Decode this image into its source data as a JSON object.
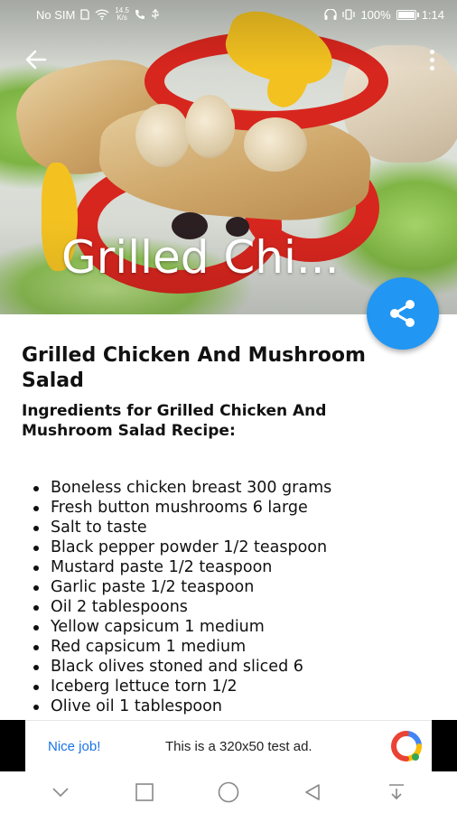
{
  "status_bar": {
    "carrier": "No SIM",
    "speed_value": "14.5",
    "speed_unit": "K/s",
    "battery": "100%",
    "battery_level": 1.0,
    "time": "1:14"
  },
  "hero": {
    "title": "Grilled Chi..."
  },
  "icons": {
    "back": "arrow-back-icon",
    "menu": "more-vert-icon",
    "share": "share-icon"
  },
  "recipe": {
    "title": "Grilled Chicken And Mushroom Salad",
    "ingredients_heading": "Ingredients for Grilled Chicken And Mushroom Salad Recipe:",
    "ingredients": [
      "Boneless chicken breast 300 grams",
      "Fresh button mushrooms 6 large",
      "Salt to taste",
      "Black pepper powder 1/2 teaspoon",
      "Mustard paste 1/2 teaspoon",
      "Garlic paste 1/2 teaspoon",
      "Oil 2 tablespoons",
      "Yellow capsicum 1 medium",
      "Red capsicum 1 medium",
      "Black olives stoned and sliced 6",
      "Iceberg lettuce torn 1/2",
      "Olive oil 1 tablespoon"
    ]
  },
  "ad": {
    "nice_job": "Nice job!",
    "text": "This is a 320x50 test ad."
  },
  "colors": {
    "fab": "#2196f3",
    "ad_link": "#1a73e8"
  }
}
